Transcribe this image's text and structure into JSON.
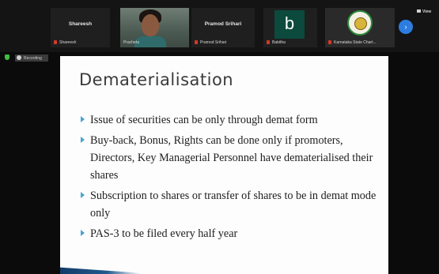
{
  "participants": [
    {
      "display": "Shareesh",
      "caption": "Shareesh",
      "muted": true,
      "type": "name"
    },
    {
      "display": "",
      "caption": "Prachetа",
      "muted": false,
      "type": "video"
    },
    {
      "display": "Pramod Srihari",
      "caption": "Pramod Srihari",
      "muted": true,
      "type": "name"
    },
    {
      "display": "b",
      "caption": "Babitha",
      "muted": true,
      "type": "avatar"
    },
    {
      "display": "",
      "caption": "Karnataka State Chart...",
      "muted": true,
      "type": "logo"
    }
  ],
  "controls": {
    "next_icon": "›",
    "view_label": "View"
  },
  "status": {
    "recording_label": "Recording"
  },
  "slide": {
    "title": "Dematerialisation",
    "bullets": [
      "Issue of securities can be only through demat form",
      "Buy-back, Bonus, Rights can be done only if promoters, Directors, Key Managerial Personnel have dematerialised their shares",
      "Subscription to shares or transfer of shares to be in demat mode only",
      "PAS-3 to be filed every half year"
    ]
  },
  "colors": {
    "bullet_arrow": "#4aa3d1",
    "mic_off": "#d23a2a",
    "security_shield": "#3fbf3f",
    "next_button": "#2d7de0"
  }
}
